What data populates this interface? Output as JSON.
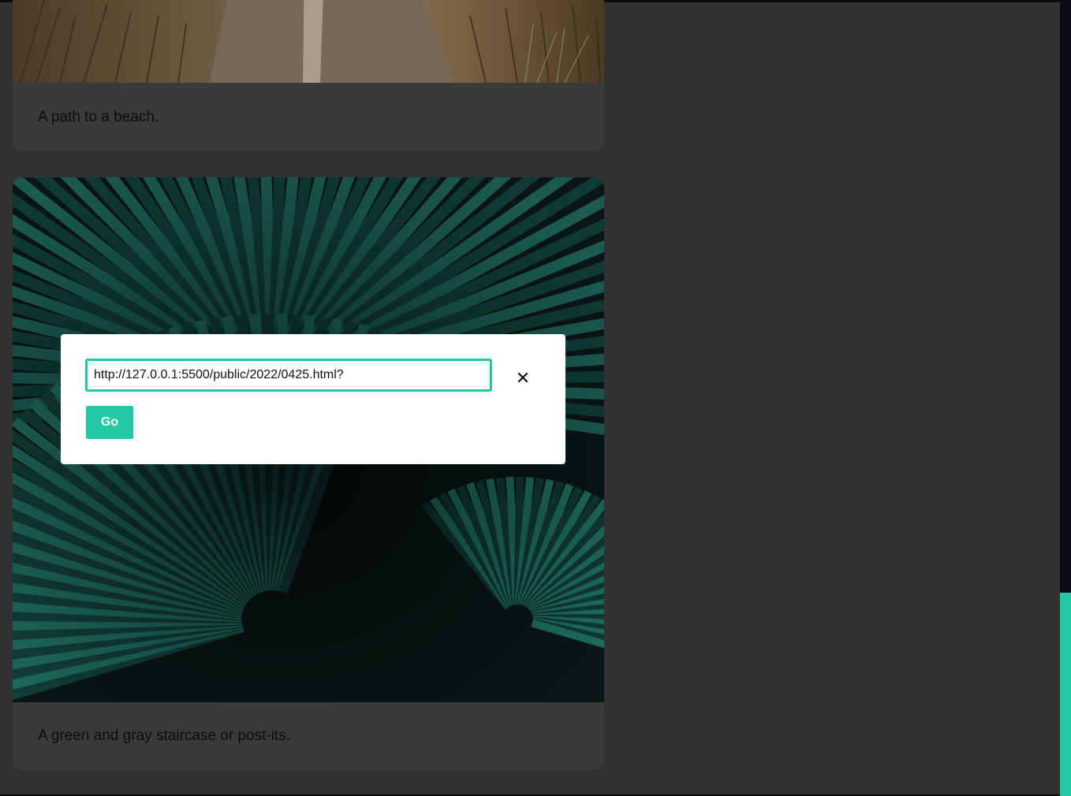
{
  "cards": [
    {
      "image_alt": "A path to a beach.",
      "caption": "A path to a beach."
    },
    {
      "image_alt": "A green and gray staircase or post-its.",
      "caption": "A green and gray staircase or post-its."
    }
  ],
  "modal": {
    "url_value": "http://127.0.0.1:5500/public/2022/0425.html?",
    "close_icon": "close-icon",
    "go_label": "Go"
  },
  "colors": {
    "accent": "#25c9a4",
    "page_bg": "#323232",
    "card_bg": "#3a3a3a",
    "scrollbar_thumb": "#25c9a4"
  },
  "scrollbar": {
    "scroll_position_fraction": 0.74
  }
}
